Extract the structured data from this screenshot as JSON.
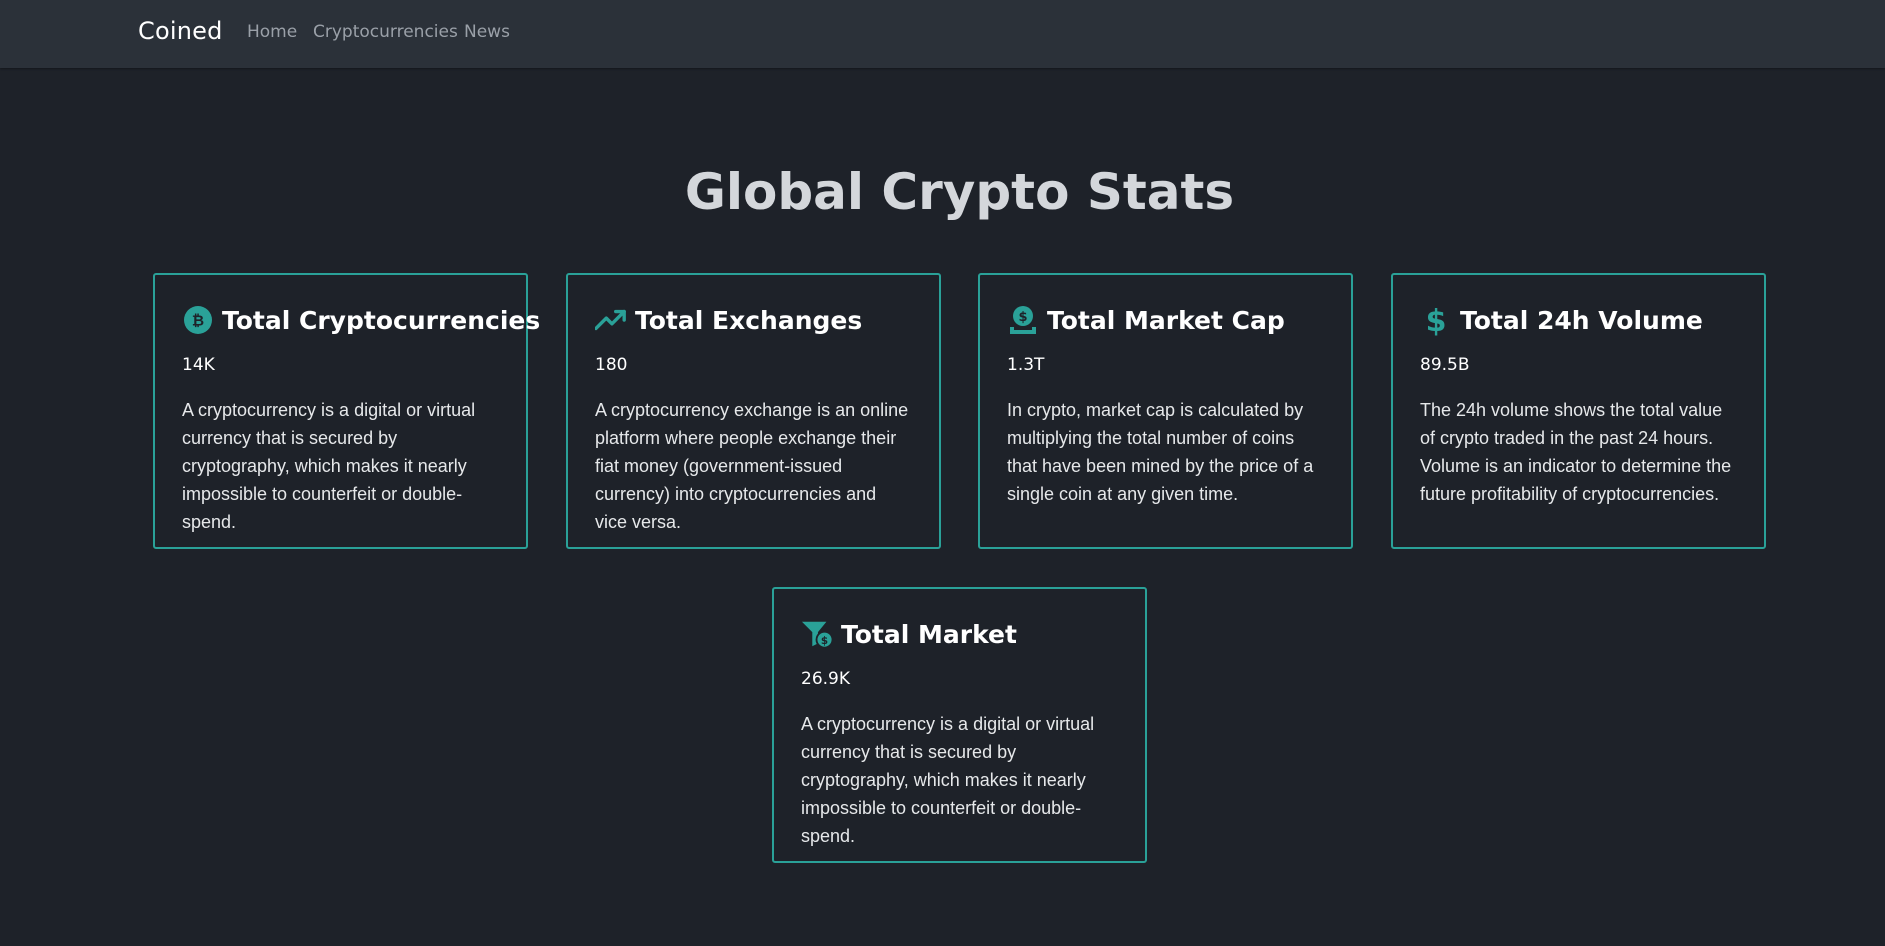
{
  "nav": {
    "brand": "Coined",
    "links": [
      "Home",
      "Cryptocurrencies",
      "News"
    ]
  },
  "page": {
    "title": "Global Crypto Stats"
  },
  "colors": {
    "accent": "#2aa198",
    "background": "#1e2229",
    "navbar": "#2b3139"
  },
  "cards": [
    {
      "icon": "bitcoin-icon",
      "title": "Total Cryptocurrencies",
      "value": "14K",
      "description": "A cryptocurrency is a digital or virtual currency that is secured by cryptography, which makes it nearly impossible to counterfeit or double-spend."
    },
    {
      "icon": "trending-up-icon",
      "title": "Total Exchanges",
      "value": "180",
      "description": "A cryptocurrency exchange is an online platform where people exchange their fiat money (government-issued currency) into cryptocurrencies and vice versa."
    },
    {
      "icon": "money-hand-icon",
      "title": "Total Market Cap",
      "value": "1.3T",
      "description": "In crypto, market cap is calculated by multiplying the total number of coins that have been mined by the price of a single coin at any given time."
    },
    {
      "icon": "dollar-icon",
      "title": "Total 24h Volume",
      "value": "89.5B",
      "description": "The 24h volume shows the total value of crypto traded in the past 24 hours. Volume is an indicator to determine the future profitability of cryptocurrencies."
    },
    {
      "icon": "funnel-dollar-icon",
      "title": "Total Market",
      "value": "26.9K",
      "description": "A cryptocurrency is a digital or virtual currency that is secured by cryptography, which makes it nearly impossible to counterfeit or double-spend."
    }
  ]
}
